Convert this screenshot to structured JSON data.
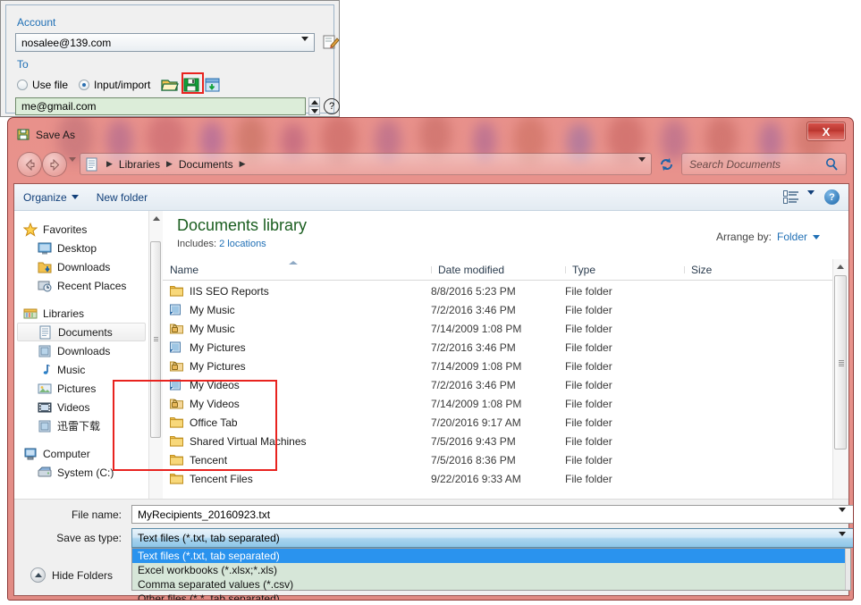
{
  "background_panel": {
    "account_label": "Account",
    "account_value": "nosalee@139.com",
    "to_label": "To",
    "radio_use_file": "Use file",
    "radio_input_import": "Input/import",
    "recipient_value": "me@gmail.com",
    "icons": {
      "edit": "edit-account-icon",
      "open": "open-folder-icon",
      "save": "save-floppy-icon",
      "import": "import-icon",
      "help": "help-icon"
    },
    "highlight_color": "#e8231f"
  },
  "dialog": {
    "title": "Save As",
    "close_label": "X",
    "titlebar_color": "#e8918b",
    "nav": {
      "breadcrumb": [
        "Libraries",
        "Documents"
      ],
      "search_placeholder": "Search Documents"
    },
    "toolbar": {
      "organize": "Organize",
      "new_folder": "New folder",
      "help": "?"
    },
    "sidebar": {
      "groups": [
        {
          "label": "Favorites",
          "icon": "star-icon",
          "items": [
            {
              "label": "Desktop",
              "icon": "desktop-icon"
            },
            {
              "label": "Downloads",
              "icon": "downloads-icon"
            },
            {
              "label": "Recent Places",
              "icon": "recent-places-icon"
            }
          ]
        },
        {
          "label": "Libraries",
          "icon": "libraries-icon",
          "items": [
            {
              "label": "Documents",
              "icon": "documents-icon",
              "selected": true
            },
            {
              "label": "Downloads",
              "icon": "downloads-library-icon"
            },
            {
              "label": "Music",
              "icon": "music-icon"
            },
            {
              "label": "Pictures",
              "icon": "pictures-icon"
            },
            {
              "label": "Videos",
              "icon": "videos-icon"
            },
            {
              "label": "迅雷下载",
              "icon": "thunder-download-icon"
            }
          ]
        },
        {
          "label": "Computer",
          "icon": "computer-icon",
          "items": [
            {
              "label": "System (C:)",
              "icon": "drive-icon"
            }
          ]
        }
      ]
    },
    "content": {
      "library_title": "Documents library",
      "includes_label": "Includes:",
      "includes_value": "2 locations",
      "arrange_label": "Arrange by:",
      "arrange_value": "Folder",
      "columns": [
        "Name",
        "Date modified",
        "Type",
        "Size"
      ],
      "rows": [
        {
          "name": "IIS SEO Reports",
          "date": "8/8/2016 5:23 PM",
          "type": "File folder",
          "size": "",
          "icon": "folder-icon"
        },
        {
          "name": "My Music",
          "date": "7/2/2016 3:46 PM",
          "type": "File folder",
          "size": "",
          "icon": "shortcut-music-icon"
        },
        {
          "name": "My Music",
          "date": "7/14/2009 1:08 PM",
          "type": "File folder",
          "size": "",
          "icon": "locked-folder-icon"
        },
        {
          "name": "My Pictures",
          "date": "7/2/2016 3:46 PM",
          "type": "File folder",
          "size": "",
          "icon": "shortcut-pictures-icon"
        },
        {
          "name": "My Pictures",
          "date": "7/14/2009 1:08 PM",
          "type": "File folder",
          "size": "",
          "icon": "locked-folder-icon"
        },
        {
          "name": "My Videos",
          "date": "7/2/2016 3:46 PM",
          "type": "File folder",
          "size": "",
          "icon": "shortcut-videos-icon"
        },
        {
          "name": "My Videos",
          "date": "7/14/2009 1:08 PM",
          "type": "File folder",
          "size": "",
          "icon": "locked-folder-icon"
        },
        {
          "name": "Office Tab",
          "date": "7/20/2016 9:17 AM",
          "type": "File folder",
          "size": "",
          "icon": "folder-icon"
        },
        {
          "name": "Shared Virtual Machines",
          "date": "7/5/2016 9:43 PM",
          "type": "File folder",
          "size": "",
          "icon": "folder-icon"
        },
        {
          "name": "Tencent",
          "date": "7/5/2016 8:36 PM",
          "type": "File folder",
          "size": "",
          "icon": "folder-icon"
        },
        {
          "name": "Tencent Files",
          "date": "9/22/2016 9:33 AM",
          "type": "File folder",
          "size": "",
          "icon": "folder-icon"
        }
      ]
    },
    "save_area": {
      "file_name_label": "File name:",
      "file_name_value": "MyRecipients_20160923.txt",
      "save_as_type_label": "Save as type:",
      "save_as_type_value": "Text files (*.txt, tab separated)",
      "dropdown_options": [
        "Text files (*.txt, tab separated)",
        "Excel workbooks (*.xlsx;*.xls)",
        "Comma separated values (*.csv)",
        "Other files (*.*, tab separated)"
      ],
      "selected_option_index": 0,
      "hide_folders_label": "Hide Folders",
      "dropdown_bg_color": "#d6e6d8",
      "dropdown_selected_color": "#2a93ee"
    }
  }
}
